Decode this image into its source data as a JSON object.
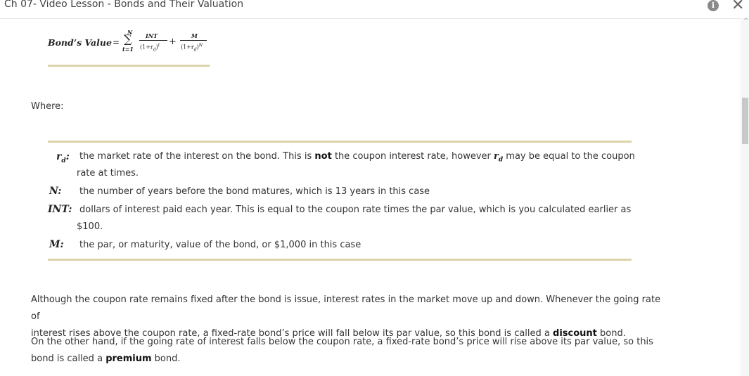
{
  "window": {
    "title": "Ch 07- Video Lesson - Bonds and Their Valuation",
    "info_icon": "i",
    "close_icon": "✕",
    "scroll_up_icon": "^"
  },
  "formula": {
    "label": "Bond’s Value",
    "equals": "=",
    "sum_symbol": "∑",
    "upper_limit": "N",
    "lower_limit": "t=1",
    "term1_numerator": "INT",
    "term1_denominator": "(1+r",
    "term1_den_sub": "d",
    "term1_den_close": ")",
    "term1_den_sup": "t",
    "plus": "+",
    "term2_numerator": "M",
    "term2_denominator": "(1+r",
    "term2_den_sub": "d",
    "term2_den_close": ")",
    "term2_den_sup": "N"
  },
  "where_label": "Where:",
  "definitions": {
    "rd_symbol": "r",
    "rd_sub": "d",
    "rd_colon": ":",
    "rd_text_a": "the market rate of the interest on the bond. This is",
    "rd_bold": "not",
    "rd_text_b": "the coupon interest rate, however",
    "rd_inline_sym": "r",
    "rd_inline_sub": "d",
    "rd_text_c": "may be equal to the coupon",
    "rd_text_line2": "rate at times.",
    "n_symbol": "N:",
    "n_text": "the number of years before the bond matures, which is 13 years in this case",
    "int_symbol": "INT:",
    "int_text": "dollars of interest paid each year. This is equal to the coupon rate times the par value, which is you calculated earlier as",
    "int_text_line2": "$100.",
    "m_symbol": "M:",
    "m_text": "the par, or maturity, value of the bond, or $1,000 in this case"
  },
  "paragraphs": {
    "p1_a": "Although the coupon rate remains fixed after the bond is issue, interest rates in the market move up and down. Whenever the going rate of",
    "p1_b": "interest rises above the coupon rate, a fixed-rate bond’s price will fall below its par value, so this bond is called a",
    "p1_bold": "discount",
    "p1_c": "bond.",
    "p2_a": "On the other hand, if the going rate of interest falls below the coupon rate, a fixed-rate bond’s price will rise above its par value, so this",
    "p2_b": "bond is called a",
    "p2_bold": "premium",
    "p2_c": "bond."
  }
}
